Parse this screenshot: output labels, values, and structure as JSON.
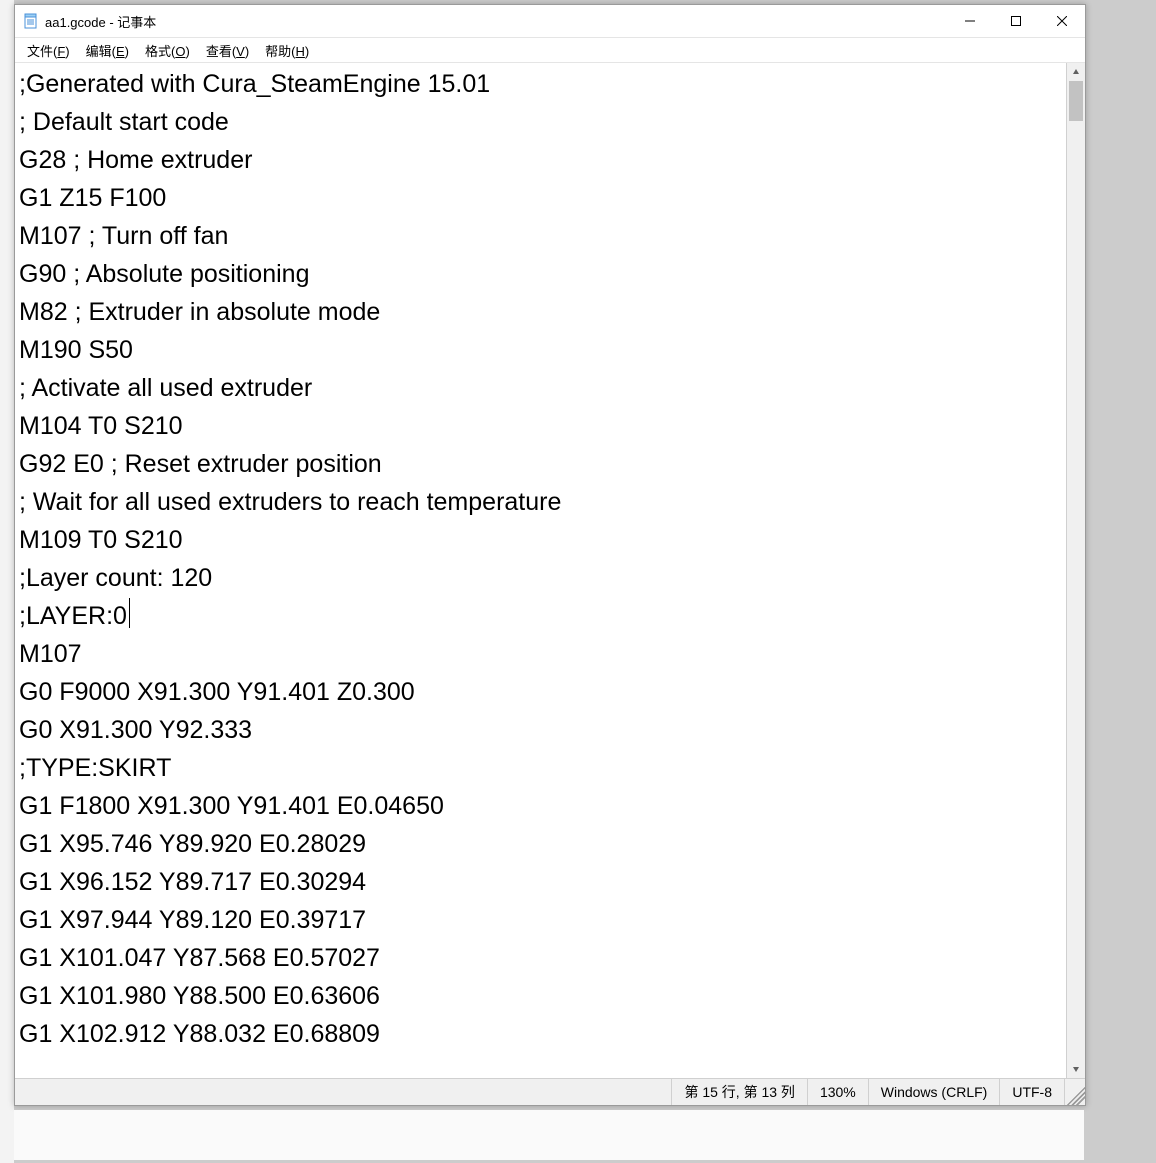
{
  "titlebar": {
    "app_name": "记事本",
    "file_name": "aa1.gcode",
    "separator": " - ",
    "title": "aa1.gcode - 记事本"
  },
  "menubar": {
    "items": [
      {
        "label_pre": "文件(",
        "accel": "F",
        "label_post": ")"
      },
      {
        "label_pre": "编辑(",
        "accel": "E",
        "label_post": ")"
      },
      {
        "label_pre": "格式(",
        "accel": "O",
        "label_post": ")"
      },
      {
        "label_pre": "查看(",
        "accel": "V",
        "label_post": ")"
      },
      {
        "label_pre": "帮助(",
        "accel": "H",
        "label_post": ")"
      }
    ]
  },
  "editor": {
    "caret_line_index": 14,
    "lines": [
      ";Generated with Cura_SteamEngine 15.01",
      "; Default start code",
      "G28 ; Home extruder",
      "G1 Z15 F100",
      "M107 ; Turn off fan",
      "G90 ; Absolute positioning",
      "M82 ; Extruder in absolute mode",
      "M190 S50",
      "; Activate all used extruder",
      "M104 T0 S210",
      "G92 E0 ; Reset extruder position",
      "; Wait for all used extruders to reach temperature",
      "M109 T0 S210",
      ";Layer count: 120",
      ";LAYER:0",
      "M107",
      "G0 F9000 X91.300 Y91.401 Z0.300",
      "G0 X91.300 Y92.333",
      ";TYPE:SKIRT",
      "G1 F1800 X91.300 Y91.401 E0.04650",
      "G1 X95.746 Y89.920 E0.28029",
      "G1 X96.152 Y89.717 E0.30294",
      "G1 X97.944 Y89.120 E0.39717",
      "G1 X101.047 Y87.568 E0.57027",
      "G1 X101.980 Y88.500 E0.63606",
      "G1 X102.912 Y88.032 E0.68809"
    ]
  },
  "statusbar": {
    "position": "第 15 行, 第 13 列",
    "zoom": "130%",
    "line_ending": "Windows (CRLF)",
    "encoding": "UTF-8"
  }
}
